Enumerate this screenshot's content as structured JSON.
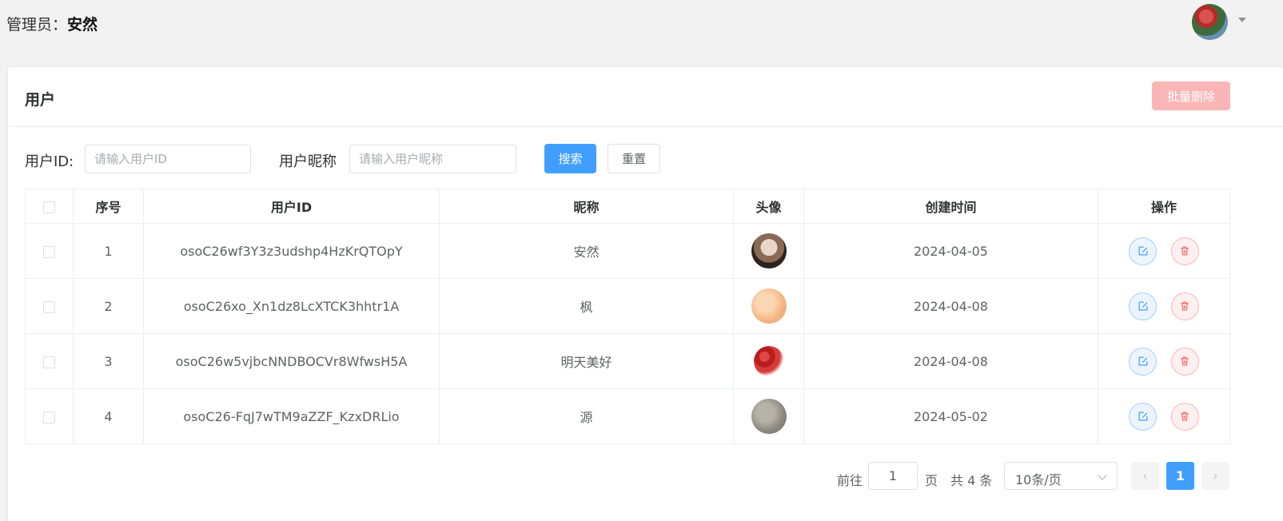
{
  "header": {
    "admin_label": "管理员：",
    "admin_name": "安然"
  },
  "card": {
    "title": "用户",
    "batch_delete_label": "批量删除"
  },
  "search": {
    "user_id_label": "用户ID:",
    "user_id_placeholder": "请输入用户ID",
    "nickname_label": "用户昵称",
    "nickname_placeholder": "请输入用户昵称",
    "search_label": "搜索",
    "reset_label": "重置"
  },
  "table": {
    "columns": [
      "序号",
      "用户ID",
      "昵称",
      "头像",
      "创建时间",
      "操作"
    ],
    "rows": [
      {
        "index": "1",
        "user_id": "osoC26wf3Y3z3udshp4HzKrQTOpY",
        "nickname": "安然",
        "created": "2024-04-05",
        "avatar": "cat-photo"
      },
      {
        "index": "2",
        "user_id": "osoC26xo_Xn1dz8LcXTCK3hhtr1A",
        "nickname": "枫",
        "created": "2024-04-08",
        "avatar": "peach-gradient"
      },
      {
        "index": "3",
        "user_id": "osoC26w5vjbcNNDBOCVr8WfwsH5A",
        "nickname": "明天美好",
        "created": "2024-04-08",
        "avatar": "red-dates"
      },
      {
        "index": "4",
        "user_id": "osoC26-FqJ7wTM9aZZF_KzxDRLio",
        "nickname": "源",
        "created": "2024-05-02",
        "avatar": "gray-texture"
      }
    ]
  },
  "pagination": {
    "goto_label": "前往",
    "goto_value": "1",
    "page_label": "页",
    "total_label": "共 4 条",
    "page_size": "10条/页",
    "current_page": "1"
  },
  "colors": {
    "primary": "#409eff",
    "danger_light": "#fab6b6"
  }
}
